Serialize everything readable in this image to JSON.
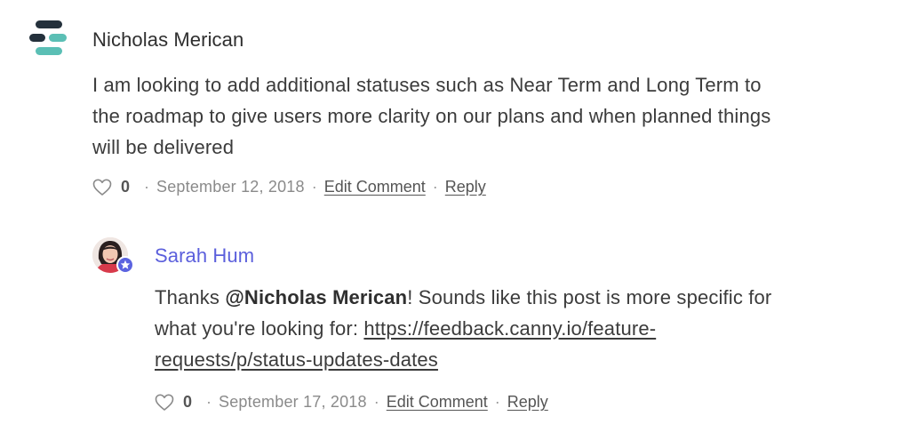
{
  "comments": [
    {
      "author": "Nicholas Merican",
      "avatar": "company-logo-icon",
      "body_lines": [
        "I am looking to add additional statuses such as Near Term and Long Term to",
        "the roadmap to give users more clarity on our plans and when planned things",
        "will be delivered"
      ],
      "like_count": "0",
      "date": "September 12, 2018",
      "edit_label": "Edit Comment",
      "reply_label": "Reply"
    },
    {
      "author": "Sarah Hum",
      "avatar": "user-photo",
      "badge": "admin-star-icon",
      "body": {
        "prefix": "Thanks ",
        "mention": "@Nicholas Merican",
        "after_mention": "! Sounds like this post is more specific for",
        "line2_text": "what you're looking for: ",
        "link_part1": "https://feedback.canny.io/feature-",
        "link_part2": "requests/p/status-updates-dates"
      },
      "like_count": "0",
      "date": "September 17, 2018",
      "edit_label": "Edit Comment",
      "reply_label": "Reply"
    }
  ],
  "colors": {
    "admin_name": "#5b5fdc",
    "logo_dark": "#24313c",
    "logo_teal": "#5bbfb5",
    "badge": "#5b63e0"
  },
  "separator": "·"
}
